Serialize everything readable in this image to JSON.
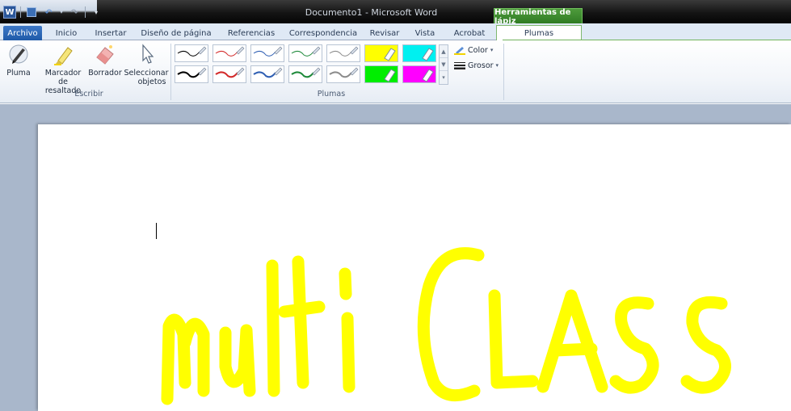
{
  "window": {
    "title": "Documento1 - Microsoft Word",
    "context_tab_group": "Herramientas de lápiz"
  },
  "quick_access": {
    "app_icon_letter": "W"
  },
  "tabs": [
    {
      "label": "Archivo"
    },
    {
      "label": "Inicio"
    },
    {
      "label": "Insertar"
    },
    {
      "label": "Diseño de página"
    },
    {
      "label": "Referencias"
    },
    {
      "label": "Correspondencia"
    },
    {
      "label": "Revisar"
    },
    {
      "label": "Vista"
    },
    {
      "label": "Acrobat"
    },
    {
      "label": "Plumas"
    }
  ],
  "ribbon": {
    "escribir": {
      "group_label": "Escribir",
      "pluma": "Pluma",
      "marcador_line1": "Marcador",
      "marcador_line2": "de resaltado",
      "borrador": "Borrador",
      "seleccionar_line1": "Seleccionar",
      "seleccionar_line2": "objetos"
    },
    "plumas": {
      "group_label": "Plumas",
      "color_label": "Color",
      "grosor_label": "Grosor"
    }
  },
  "pen_styles": [
    {
      "color": "#000000",
      "kind": "pen"
    },
    {
      "color": "#d32a2a",
      "kind": "pen"
    },
    {
      "color": "#2f5fb3",
      "kind": "pen"
    },
    {
      "color": "#1f8a3b",
      "kind": "pen"
    },
    {
      "color": "#8c8c8c",
      "kind": "pen"
    },
    {
      "color": "#ffff00",
      "kind": "highlighter"
    },
    {
      "color": "#00f0f0",
      "kind": "highlighter"
    },
    {
      "color": "#000000",
      "kind": "pen-thick"
    },
    {
      "color": "#d32a2a",
      "kind": "pen-thick"
    },
    {
      "color": "#2f5fb3",
      "kind": "pen-thick"
    },
    {
      "color": "#1f8a3b",
      "kind": "pen-thick"
    },
    {
      "color": "#8c8c8c",
      "kind": "pen-thick"
    },
    {
      "color": "#00ee00",
      "kind": "highlighter"
    },
    {
      "color": "#ff00ff",
      "kind": "highlighter"
    }
  ],
  "document": {
    "ink_text": "multiCLASS",
    "ink_color": "#ffff00"
  },
  "colors": {
    "ribbon_accent": "#2b579a",
    "context_tab": "#4e9b3c"
  }
}
